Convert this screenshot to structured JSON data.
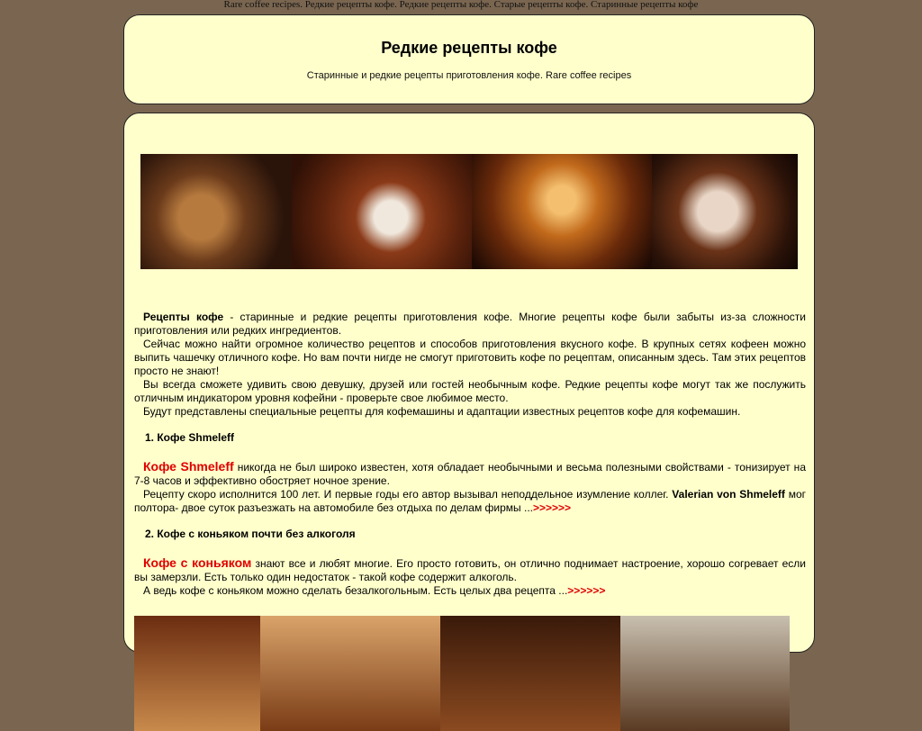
{
  "top_banner_text": "Rare coffee recipes. Редкие рецепты кофе. Редкие рецепты кофе. Старые рецепты кофе. Старинные рецепты кофе",
  "header": {
    "title": "Редкие рецепты кофе",
    "subtitle": "Старинные и редкие рецепты приготовления кофе. Rare coffee recipes"
  },
  "intro": {
    "lead": "Рецепты кофе",
    "p1_rest": " - старинные и редкие рецепты приготовления кофе. Многие рецепты кофе были забыты из-за сложности приготовления или редких ингредиентов.",
    "p2": "Сейчас можно найти огромное количество рецептов и способов приготовления вкусного кофе. В крупных сетях кофеен можно выпить чашечку отличного кофе. Но вам почти нигде не смогут приготовить кофе по рецептам, описанным здесь. Там этих рецептов просто не знают!",
    "p3": "Вы всегда сможете удивить свою девушку, друзей или гостей необычным кофе. Редкие рецепты кофе могут так же послужить отличным индикатором уровня кофейни - проверьте свое любимое место.",
    "p4": "Будут представлены специальные рецепты для кофемашины и адаптации известных рецептов кофе для кофемашин."
  },
  "recipes": [
    {
      "heading_num": "1.",
      "heading": "Кофе Shmeleff",
      "red": "Кофе Shmeleff",
      "p1_rest": " никогда не был широко известен, хотя обладает необычными и весьма полезными свойствами - тонизирует на 7-8 часов и эффективно обостряет ночное зрение.",
      "p2_pre": "Рецепту скоро исполнится 100 лет. И первые годы его автор вызывал неподдельное изумление коллег. ",
      "p2_bold": "Valerian von Shmeleff",
      "p2_post": " мог полтора- двое суток разъезжать на автомобиле без отдыха по делам фирмы ...",
      "more": ">>>>>>"
    },
    {
      "heading_num": "2.",
      "heading": "Кофе с коньяком почти без алкоголя",
      "red": "Кофе с коньяком",
      "p1_rest": " знают все и любят многие. Его просто готовить, он отлично поднимает настроение, хорошо согревает если вы замерзли. Есть только один недостаток - такой кофе содержит алкоголь.",
      "p2": "А ведь кофе с коньяком можно сделать безалкогольным. Есть целых два рецепта ...",
      "more": ">>>>>>"
    }
  ]
}
